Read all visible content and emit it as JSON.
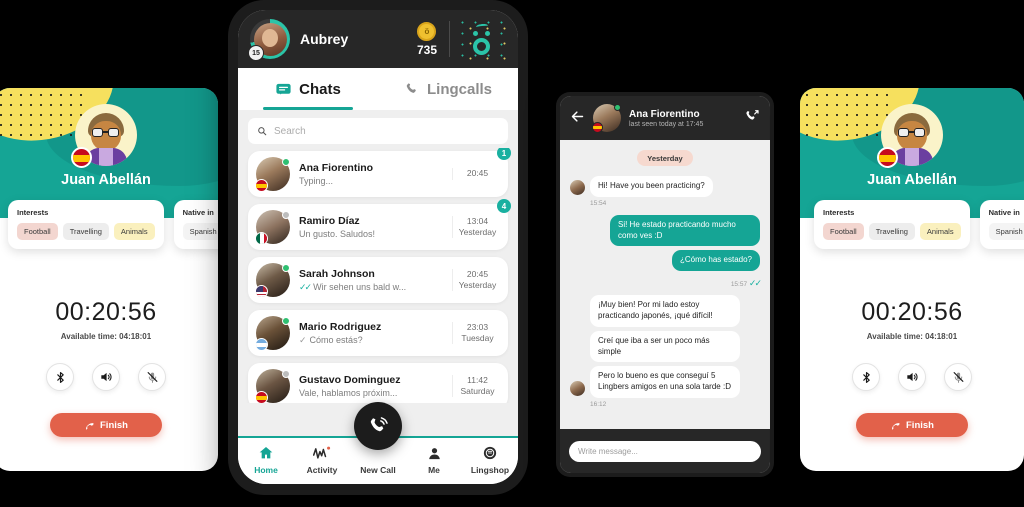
{
  "colors": {
    "teal": "#15A595",
    "dark": "#272727",
    "coral": "#E2614A",
    "yellow": "#F6E05E",
    "badge": "#19B0A0",
    "page_background": "#000000"
  },
  "profile_card": {
    "name": "Juan Abellán",
    "flag_icon": "spain-flag-icon",
    "interests": {
      "title": "Interests",
      "tags": [
        "Football",
        "Travelling",
        "Animals"
      ]
    },
    "native": {
      "title": "Native in",
      "tags": [
        "Spanish"
      ]
    },
    "timer": "00:20:56",
    "available_time": "Available time: 04:18:01",
    "controls": [
      {
        "name": "bluetooth-button",
        "icon": "bluetooth-icon"
      },
      {
        "name": "speaker-button",
        "icon": "speaker-icon"
      },
      {
        "name": "mute-button",
        "icon": "microphone-muted-icon"
      }
    ],
    "finish_label": "Finish",
    "finish_icon": "hang-up-icon"
  },
  "phone": {
    "header": {
      "user_name": "Aubrey",
      "level": "15",
      "coin_value": "735",
      "coin_icon": "coin-icon",
      "logo_icon": "lingbe-logo-icon",
      "avatar_name": "user-avatar"
    },
    "tabs": [
      {
        "label": "Chats",
        "icon": "chat-bubble-icon",
        "active": true
      },
      {
        "label": "Lingcalls",
        "icon": "phone-icon",
        "active": false
      }
    ],
    "search": {
      "placeholder": "Search",
      "icon": "search-icon"
    },
    "chats": [
      {
        "name": "Ana Fiorentino",
        "message": "Typing...",
        "time": "20:45",
        "day": "",
        "badge": "1",
        "online": true,
        "flag": "spain-flag-icon",
        "status_icon": ""
      },
      {
        "name": "Ramiro Díaz",
        "message": "Un gusto. Saludos!",
        "time": "13:04",
        "day": "Yesterday",
        "badge": "4",
        "online": false,
        "flag": "mexico-flag-icon",
        "status_icon": ""
      },
      {
        "name": "Sarah Johnson",
        "message": "Wir sehen uns bald w...",
        "time": "20:45",
        "day": "Yesterday",
        "badge": "",
        "online": true,
        "flag": "usa-flag-icon",
        "status_icon": "double-check-read-icon"
      },
      {
        "name": "Mario Rodriguez",
        "message": "Cómo estás?",
        "time": "23:03",
        "day": "Tuesday",
        "badge": "",
        "online": true,
        "flag": "argentina-flag-icon",
        "status_icon": "single-check-icon"
      },
      {
        "name": "Gustavo Dominguez",
        "message": "Vale, hablamos próxim...",
        "time": "11:42",
        "day": "Saturday",
        "badge": "",
        "online": false,
        "flag": "spain-flag-icon",
        "status_icon": ""
      }
    ],
    "nav": [
      {
        "label": "Home",
        "icon": "home-icon",
        "active": true
      },
      {
        "label": "Activity",
        "icon": "activity-pulse-icon",
        "active": false
      },
      {
        "label": "New Call",
        "icon": "phone-call-icon",
        "active": false
      },
      {
        "label": "Me",
        "icon": "person-icon",
        "active": false
      },
      {
        "label": "Lingshop",
        "icon": "shop-coin-icon",
        "active": false
      }
    ]
  },
  "chat_detail": {
    "back_icon": "arrow-left-icon",
    "call_icon": "outgoing-call-icon",
    "contact_name": "Ana Fiorentino",
    "last_seen": "last seen today at 17:45",
    "flag": "spain-flag-icon",
    "day_divider": "Yesterday",
    "messages": [
      {
        "side": "in",
        "text": "Hi! Have you been practicing?",
        "time": "15:54",
        "status": ""
      },
      {
        "side": "out",
        "text": "Si! He estado practicando mucho como ves :D",
        "time": "",
        "status": ""
      },
      {
        "side": "out",
        "text": "¿Cómo has estado?",
        "time": "15:57",
        "status": "double-check-read-icon"
      },
      {
        "side": "in",
        "text": "¡Muy bien! Por mi lado estoy practicando japonés, ¡qué difícil!",
        "time": "",
        "status": ""
      },
      {
        "side": "in",
        "text": "Creí que iba a ser un poco más simple",
        "time": "",
        "status": ""
      },
      {
        "side": "in",
        "text": "Pero lo bueno es que conseguí 5 Lingbers amigos en una sola tarde :D",
        "time": "16:12",
        "status": ""
      }
    ],
    "input_placeholder": "Write message..."
  }
}
